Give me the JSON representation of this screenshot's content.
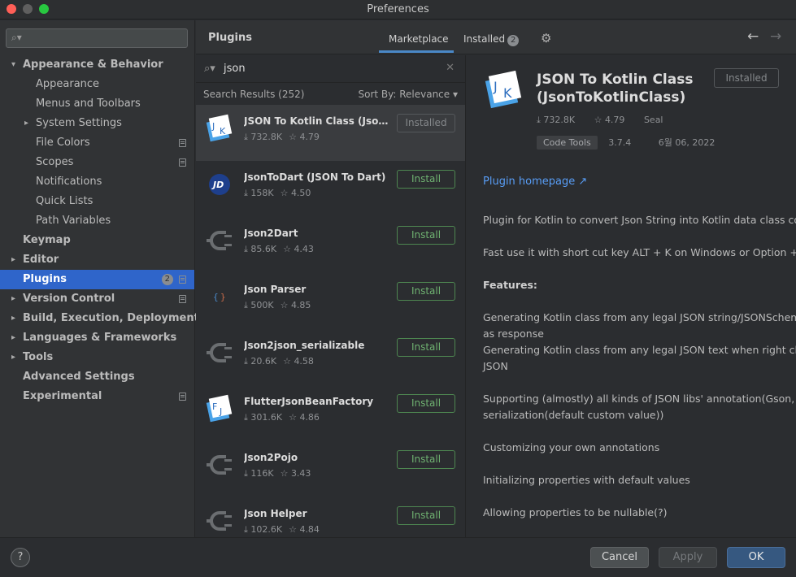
{
  "window": {
    "title": "Preferences"
  },
  "sidebar": {
    "search_placeholder": "",
    "items": [
      {
        "label": "Appearance & Behavior",
        "level": 0,
        "expanded": true,
        "bold": true
      },
      {
        "label": "Appearance",
        "level": 1
      },
      {
        "label": "Menus and Toolbars",
        "level": 1
      },
      {
        "label": "System Settings",
        "level": 1,
        "expandable": true
      },
      {
        "label": "File Colors",
        "level": 1,
        "project_icon": true
      },
      {
        "label": "Scopes",
        "level": 1,
        "project_icon": true
      },
      {
        "label": "Notifications",
        "level": 1
      },
      {
        "label": "Quick Lists",
        "level": 1
      },
      {
        "label": "Path Variables",
        "level": 1
      },
      {
        "label": "Keymap",
        "level": 0,
        "bold": true
      },
      {
        "label": "Editor",
        "level": 0,
        "bold": true,
        "expandable": true
      },
      {
        "label": "Plugins",
        "level": 0,
        "bold": true,
        "selected": true,
        "badge": "2",
        "project_icon": true
      },
      {
        "label": "Version Control",
        "level": 0,
        "bold": true,
        "expandable": true,
        "project_icon": true
      },
      {
        "label": "Build, Execution, Deployment",
        "level": 0,
        "bold": true,
        "expandable": true
      },
      {
        "label": "Languages & Frameworks",
        "level": 0,
        "bold": true,
        "expandable": true
      },
      {
        "label": "Tools",
        "level": 0,
        "bold": true,
        "expandable": true
      },
      {
        "label": "Advanced Settings",
        "level": 0,
        "bold": true
      },
      {
        "label": "Experimental",
        "level": 0,
        "bold": true,
        "project_icon": true
      }
    ]
  },
  "plugins_header": {
    "title": "Plugins",
    "tab_marketplace": "Marketplace",
    "tab_installed": "Installed",
    "installed_badge": "2"
  },
  "search": {
    "query": "json",
    "results_label": "Search Results (252)",
    "sort_label": "Sort By: Relevance"
  },
  "plugins": [
    {
      "name": "JSON To Kotlin Class (JsonToKotlinClass)",
      "downloads": "732.8K",
      "rating": "4.79",
      "button": "Installed",
      "installed": true,
      "icon": "jk-icon",
      "selected": true
    },
    {
      "name": "JsonToDart (JSON To Dart)",
      "downloads": "158K",
      "rating": "4.50",
      "button": "Install",
      "icon": "jd-icon"
    },
    {
      "name": "Json2Dart",
      "downloads": "85.6K",
      "rating": "4.43",
      "button": "Install",
      "icon": "plug-icon"
    },
    {
      "name": "Json Parser",
      "downloads": "500K",
      "rating": "4.85",
      "button": "Install",
      "icon": "braces-icon"
    },
    {
      "name": "Json2json_serializable",
      "downloads": "20.6K",
      "rating": "4.58",
      "button": "Install",
      "icon": "plug-icon"
    },
    {
      "name": "FlutterJsonBeanFactory",
      "downloads": "301.6K",
      "rating": "4.86",
      "button": "Install",
      "icon": "fj-icon"
    },
    {
      "name": "Json2Pojo",
      "downloads": "116K",
      "rating": "3.43",
      "button": "Install",
      "icon": "plug-icon"
    },
    {
      "name": "Json Helper",
      "downloads": "102.6K",
      "rating": "4.84",
      "button": "Install",
      "icon": "plug-icon"
    }
  ],
  "detail": {
    "title_line1": "JSON To Kotlin Class",
    "title_line2": "(JsonToKotlinClass)",
    "button": "Installed",
    "downloads": "732.8K",
    "rating": "4.79",
    "vendor": "Seal",
    "tag": "Code Tools",
    "version": "3.7.4",
    "date": "6월 06, 2022",
    "homepage_link": "Plugin homepage ↗",
    "body": [
      "Plugin for Kotlin to convert Json String into Kotlin data class code quickly",
      "",
      "Fast use it with short cut key ALT + K on Windows or Option + K on Mac",
      "",
      "Features:",
      "",
      "Generating Kotlin class from any legal JSON string/JSONSchema or any URLs that returns a JSON string",
      "as response",
      "Generating Kotlin class from any legal JSON text when right click on directory and select New -> Kotlin class File from",
      "JSON",
      "",
      "Supporting (almostly) all kinds of JSON libs' annotation(Gson, Jackson, Fastjson, MoShi and LoganSquare, kotlinx",
      "serialization(default custom value))",
      "",
      "Customizing your own annotations",
      "",
      "Initializing properties with default values",
      "",
      "Allowing properties to be nullable(?)"
    ]
  },
  "footer": {
    "help": "?",
    "cancel": "Cancel",
    "apply": "Apply",
    "ok": "OK"
  },
  "colors": {
    "accent": "#2f65ca",
    "install_green": "#6fb271",
    "link_blue": "#589df6"
  }
}
